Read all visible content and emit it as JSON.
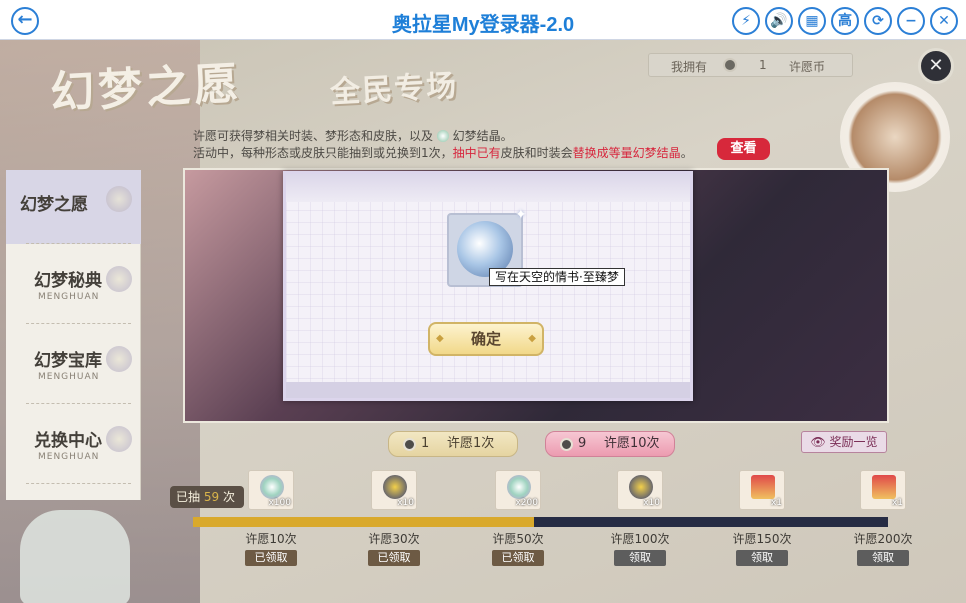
{
  "window": {
    "title": "奥拉星My登录器-2.0",
    "back_icon": "back-arrow-icon",
    "buttons": [
      {
        "name": "flash-icon",
        "glyph": "⚡"
      },
      {
        "name": "sound-icon",
        "glyph": "🔊"
      },
      {
        "name": "grid-icon",
        "glyph": "▦"
      },
      {
        "name": "high-quality-button",
        "glyph": "高"
      },
      {
        "name": "refresh-icon",
        "glyph": "⟳"
      },
      {
        "name": "minimize-icon",
        "glyph": "−"
      },
      {
        "name": "close-icon",
        "glyph": "✕"
      }
    ],
    "accent": "#1e7fd8"
  },
  "banner": {
    "title": "幻梦之愿",
    "subtitle": "全民专场"
  },
  "wallet": {
    "label": "我拥有",
    "count": "1",
    "currency": "许愿币"
  },
  "description": {
    "line1": "许愿可获得梦相关时装、梦形态和皮肤，以及",
    "line1_tail": "幻梦结晶。",
    "line2_a": "活动中，每种形态或皮肤只能抽到或兑换到1次，",
    "line2_red1": "抽中已有",
    "line2_b": "皮肤和时装会",
    "line2_red2": "替换成等量幻梦结晶",
    "line2_end": "。",
    "check_label": "查看"
  },
  "nav": [
    {
      "zh": "幻梦之愿",
      "en": "",
      "active": true
    },
    {
      "zh": "幻梦秘典",
      "en": "MENGHUAN",
      "active": false
    },
    {
      "zh": "幻梦宝库",
      "en": "MENGHUAN",
      "active": false
    },
    {
      "zh": "兑换中心",
      "en": "MENGHUAN",
      "active": false
    }
  ],
  "modal": {
    "item_tooltip": "写在天空的情书·至臻梦",
    "confirm_label": "确定"
  },
  "wish": {
    "single": {
      "count": "1",
      "label": "许愿1次"
    },
    "ten": {
      "count": "9",
      "label": "许愿10次"
    },
    "rewards_label": "奖励一览"
  },
  "progress": {
    "drawn_label": "已抽",
    "drawn_count": "59",
    "drawn_unit": "次",
    "fill_fraction": 0.49,
    "milestones": [
      {
        "tier": "许愿10次",
        "qty": "x100",
        "status": "已领取",
        "done": true
      },
      {
        "tier": "许愿30次",
        "qty": "x10",
        "status": "已领取",
        "done": true
      },
      {
        "tier": "许愿50次",
        "qty": "x200",
        "status": "已领取",
        "done": true
      },
      {
        "tier": "许愿100次",
        "qty": "x10",
        "status": "领取",
        "done": false
      },
      {
        "tier": "许愿150次",
        "qty": "x1",
        "status": "领取",
        "done": false
      },
      {
        "tier": "许愿200次",
        "qty": "x1",
        "status": "领取",
        "done": false
      }
    ]
  }
}
